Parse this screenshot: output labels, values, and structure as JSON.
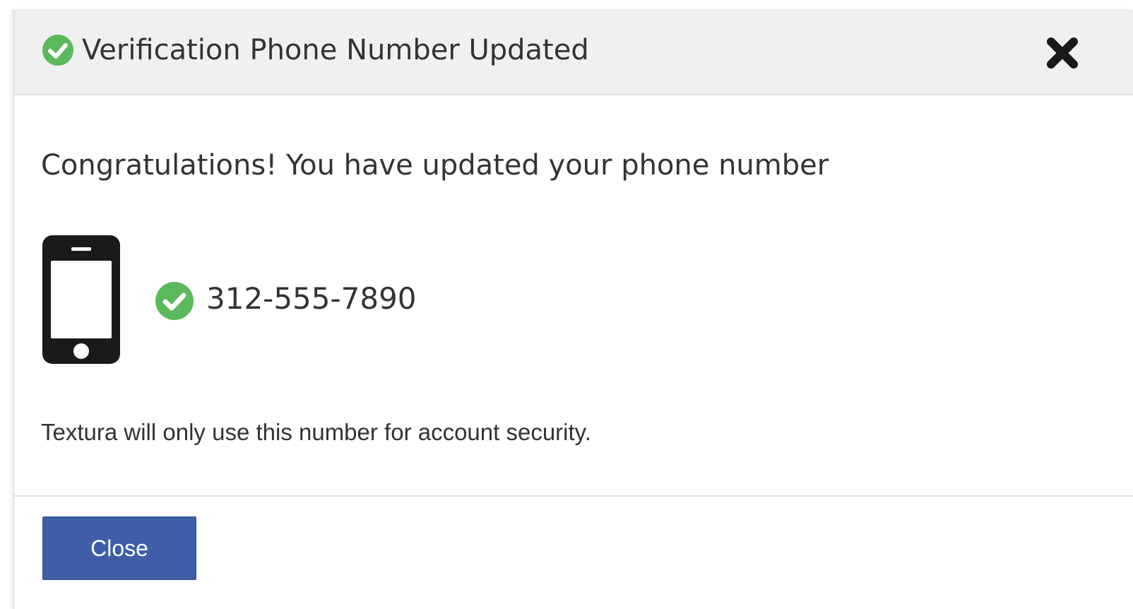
{
  "dialog": {
    "title": "Verification Phone Number Updated",
    "title_icon": "check-circle-icon",
    "close_icon": "close-x-icon",
    "congratulations_message": "Congratulations! You have updated your phone number",
    "phone_icon": "smartphone-icon",
    "phone_status_icon": "check-circle-icon",
    "phone_number": "312-555-7890",
    "security_note": "Textura will only use this number for account security.",
    "close_button_label": "Close"
  },
  "colors": {
    "success_green": "#5cb85c",
    "primary_button": "#3e5ea8",
    "header_background": "#f0f0f0",
    "text": "#333333",
    "icon_dark": "#1a1a1a"
  }
}
